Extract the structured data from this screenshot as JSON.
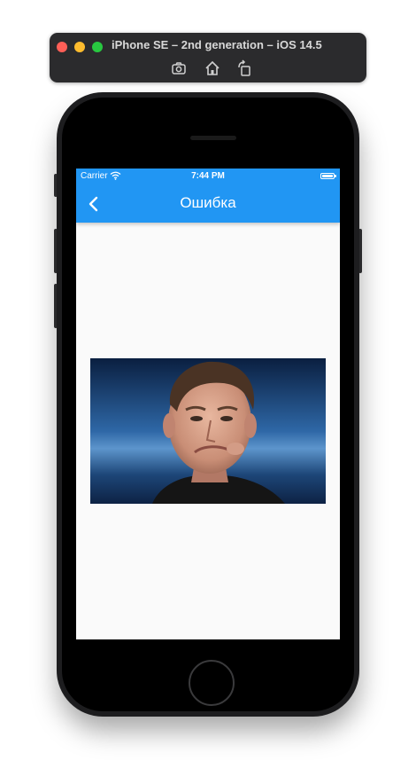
{
  "simulator": {
    "title": "iPhone SE – 2nd generation – iOS 14.5",
    "buttons": [
      "screenshot-icon",
      "home-icon",
      "rotate-icon"
    ]
  },
  "status_bar": {
    "carrier": "Carrier",
    "time": "7:44 PM"
  },
  "app_bar": {
    "title": "Ошибка",
    "color": "#2196F3"
  },
  "content": {
    "image": "portrait-photo"
  }
}
